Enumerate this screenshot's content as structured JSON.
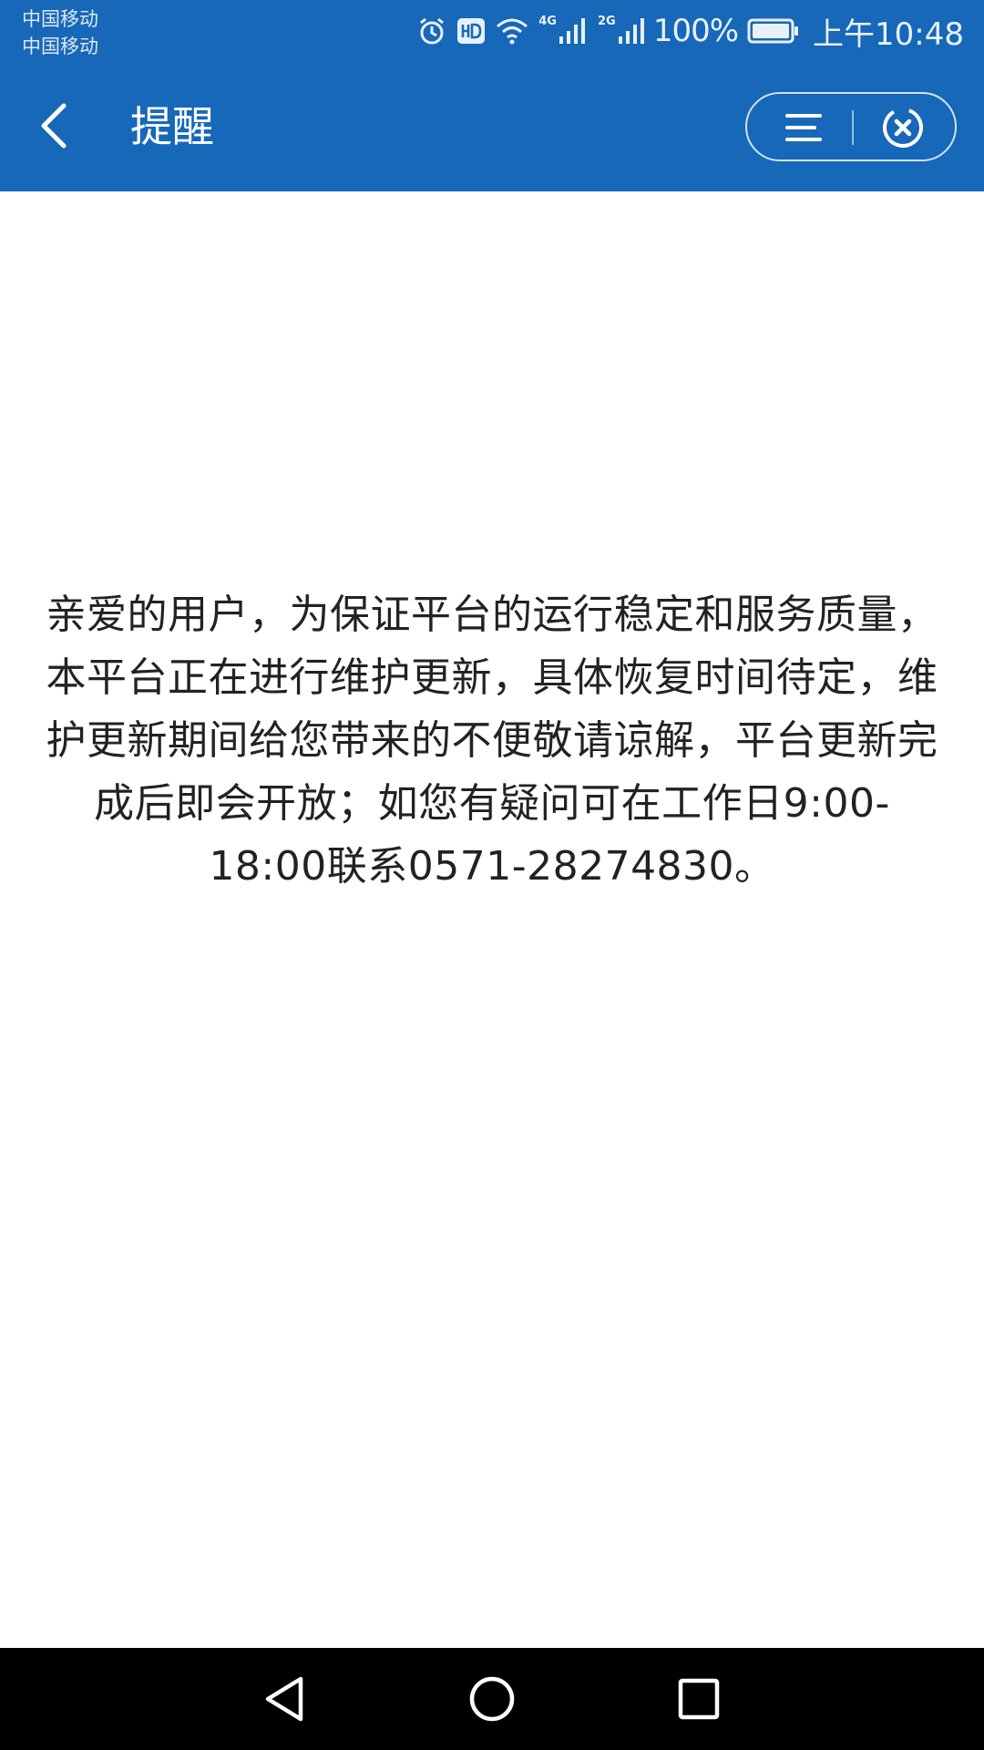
{
  "status_bar": {
    "carrier_1": "中国移动",
    "carrier_2": "中国移动",
    "network_1": "4G",
    "network_2": "2G",
    "battery_percent": "100%",
    "time": "上午10:48",
    "icons": [
      "alarm-icon",
      "hd-icon",
      "wifi-icon",
      "signal-icon",
      "signal-icon",
      "battery-icon"
    ]
  },
  "header": {
    "title": "提醒",
    "background_color": "#1768b8",
    "icons": [
      "back-arrow-icon",
      "menu-icon",
      "close-icon"
    ]
  },
  "main": {
    "message": "亲爱的用户，为保证平台的运行稳定和服务质量，本平台正在进行维护更新，具体恢复时间待定，维护更新期间给您带来的不便敬请谅解，平台更新完成后即会开放；如您有疑问可在工作日9:00-18:00联系0571-28274830。"
  },
  "nav_bar": {
    "icons": [
      "back-triangle-icon",
      "home-circle-icon",
      "recents-square-icon"
    ]
  }
}
